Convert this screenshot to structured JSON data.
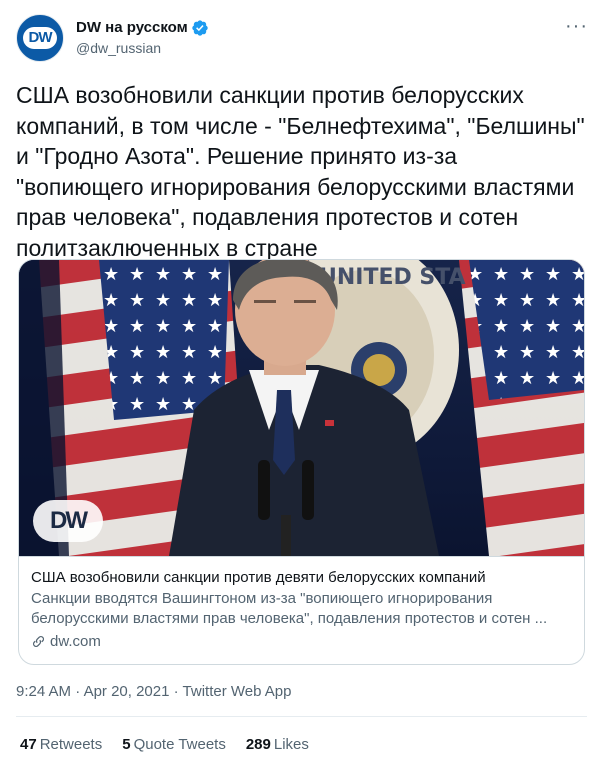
{
  "author": {
    "display_name": "DW на русском",
    "handle": "@dw_russian",
    "avatar_text": "DW"
  },
  "tweet": {
    "text": "США возобновили санкции против белорусских компаний, в том числе - \"Белнефтехима\", \"Белшины\" и \"Гродно Азота\". Решение принято из-за \"вопиющего игнорирования белорусскими властями прав человека\", подавления протестов и сотен политзаключенных в стране"
  },
  "card": {
    "watermark": "DW",
    "title": "США возобновили санкции против девяти белорусских компаний",
    "description": "Санкции вводятся Вашингтоном из-за \"вопиющего игнорирования белорусскими властями прав человека\", подавления протестов и сотен ...",
    "domain": "dw.com"
  },
  "meta": {
    "time": "9:24 AM",
    "date": "Apr 20, 2021",
    "source": "Twitter Web App",
    "separator": "·"
  },
  "stats": {
    "retweets_count": "47",
    "retweets_label": "Retweets",
    "quotes_count": "5",
    "quotes_label": "Quote Tweets",
    "likes_count": "289",
    "likes_label": "Likes"
  },
  "colors": {
    "brand": "#0c5aa6",
    "verified": "#1d9bf0",
    "secondary_text": "#536471"
  }
}
